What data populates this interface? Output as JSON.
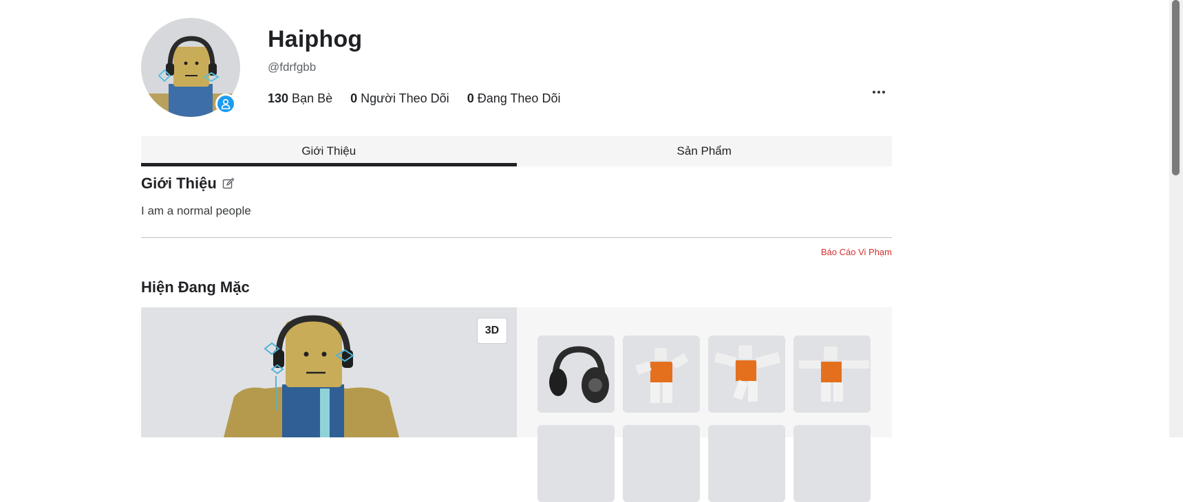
{
  "profile": {
    "display_name": "Haiphog",
    "username": "@fdrfgbb",
    "stats": [
      {
        "count": "130",
        "label": "Bạn Bè"
      },
      {
        "count": "0",
        "label": "Người Theo Dõi"
      },
      {
        "count": "0",
        "label": "Đang Theo Dõi"
      }
    ]
  },
  "tabs": [
    {
      "label": "Giới Thiệu",
      "active": true
    },
    {
      "label": "Sản Phẩm",
      "active": false
    }
  ],
  "about": {
    "title": "Giới Thiệu",
    "text": "I am a normal people",
    "report_label": "Báo Cáo Vi Phạm"
  },
  "wearing": {
    "title": "Hiện Đang Mặc",
    "view_toggle": "3D",
    "items": [
      {
        "icon": "headphones-icon"
      },
      {
        "icon": "animation-pose-icon"
      },
      {
        "icon": "animation-pose-icon"
      },
      {
        "icon": "animation-pose-icon"
      }
    ]
  },
  "colors": {
    "accent": "#1f2124",
    "presence": "#1d9bf0",
    "report": "#d32f2f"
  }
}
